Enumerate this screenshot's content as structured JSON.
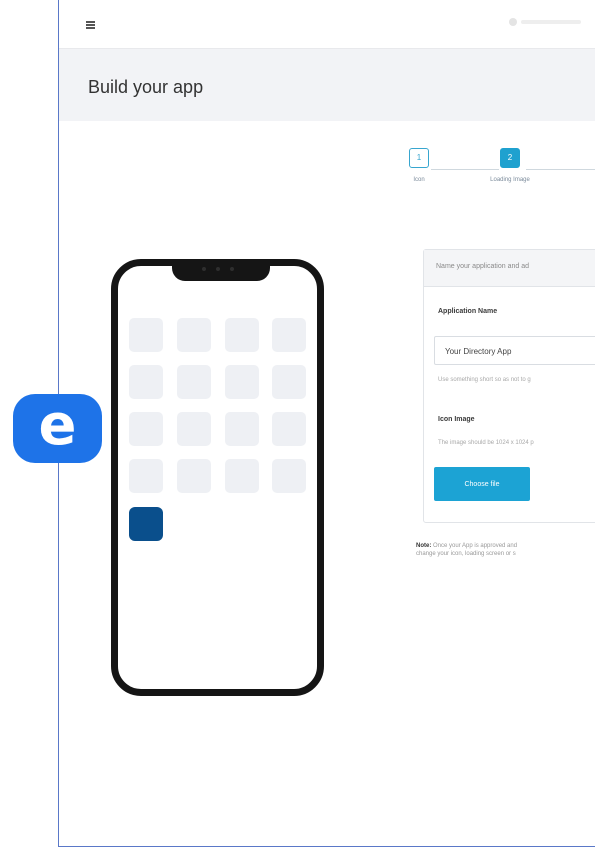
{
  "header": {
    "title": "Build your app"
  },
  "stepper": {
    "steps": [
      {
        "number": "1",
        "label": "Icon",
        "active": false
      },
      {
        "number": "2",
        "label": "Loading Image",
        "active": true
      }
    ]
  },
  "form": {
    "card_title": "Name your application and ad",
    "app_name_label": "Application Name",
    "app_name_value": "Your Directory App",
    "app_name_help": "Use something short so as not to g",
    "icon_label": "Icon Image",
    "icon_help": "The image should be 1024 x 1024 p",
    "choose_file_label": "Choose file"
  },
  "note": {
    "prefix": "Note:",
    "line1": "Once your App is approved and",
    "line2": "change your icon, loading screen or s"
  },
  "badge": {
    "letter": "e"
  },
  "colors": {
    "accent": "#1ca3d4",
    "brand": "#1e73e8",
    "tile_highlight": "#0a4f8c"
  }
}
